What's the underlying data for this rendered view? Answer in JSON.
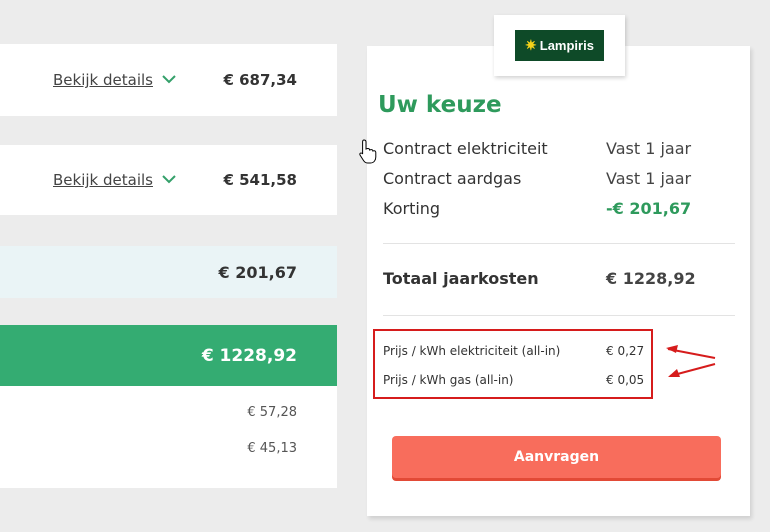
{
  "cost_rows": [
    {
      "details_label": "Bekijk details ",
      "amount": "€ 687,34"
    },
    {
      "details_label": "Bekijk details ",
      "amount": "€ 541,58"
    }
  ],
  "discount_amount": "€ 201,67",
  "total_amount": "€ 1228,92",
  "small_amounts": [
    "€ 57,28",
    "€ 45,13"
  ],
  "logo": {
    "text": "Lampiris"
  },
  "summary": {
    "title": "Uw keuze",
    "items": [
      {
        "label": "Contract elektriciteit",
        "value": "Vast 1 jaar"
      },
      {
        "label": "Contract aardgas",
        "value": "Vast 1 jaar"
      },
      {
        "label": "Korting",
        "value": "-€ 201,67"
      }
    ],
    "total_label": "Totaal jaarkosten",
    "total_value": "€ 1228,92",
    "prices": [
      {
        "label": "Prijs / kWh elektriciteit (all-in)",
        "value": "€ 0,27"
      },
      {
        "label": "Prijs / kWh gas (all-in)",
        "value": "€ 0,05"
      }
    ],
    "cta_label": "Aanvragen"
  },
  "colors": {
    "brand_green": "#2e9a5c",
    "total_bar": "#34ac72",
    "cta": "#f86d5c",
    "highlight": "#d61c1c"
  }
}
